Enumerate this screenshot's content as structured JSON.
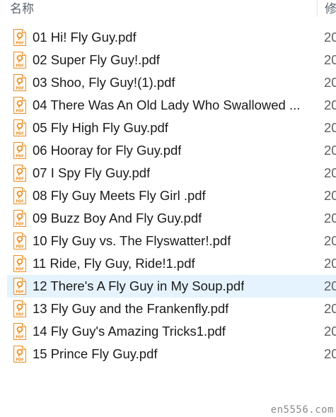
{
  "header": {
    "name_label": "名称",
    "modified_label": "修"
  },
  "files": [
    {
      "name": "01 Hi! Fly Guy.pdf",
      "date": "20"
    },
    {
      "name": "02 Super Fly Guy!.pdf",
      "date": "20"
    },
    {
      "name": "03 Shoo, Fly Guy!(1).pdf",
      "date": "20"
    },
    {
      "name": "04 There Was An Old Lady Who Swallowed ...",
      "date": "20"
    },
    {
      "name": "05 Fly High Fly Guy.pdf",
      "date": "20"
    },
    {
      "name": "06 Hooray for Fly Guy.pdf",
      "date": "20"
    },
    {
      "name": "07 I Spy Fly Guy.pdf",
      "date": "20"
    },
    {
      "name": "08 Fly Guy Meets Fly Girl .pdf",
      "date": "20"
    },
    {
      "name": "09 Buzz Boy And Fly Guy.pdf",
      "date": "20"
    },
    {
      "name": "10 Fly Guy vs. The Flyswatter!.pdf",
      "date": "20"
    },
    {
      "name": "11 Ride, Fly Guy, Ride!1.pdf",
      "date": "20"
    },
    {
      "name": "12 There's A Fly Guy in My Soup.pdf",
      "date": "20",
      "hovered": true
    },
    {
      "name": "13 Fly Guy and the Frankenfly.pdf",
      "date": "20"
    },
    {
      "name": "14 Fly Guy's Amazing Tricks1.pdf",
      "date": "20"
    },
    {
      "name": "15 Prince Fly Guy.pdf",
      "date": "20"
    }
  ],
  "icon": {
    "name": "pdf-file-icon",
    "label": "PDF",
    "accent": "#e8902a"
  },
  "watermark": "en5556.com"
}
